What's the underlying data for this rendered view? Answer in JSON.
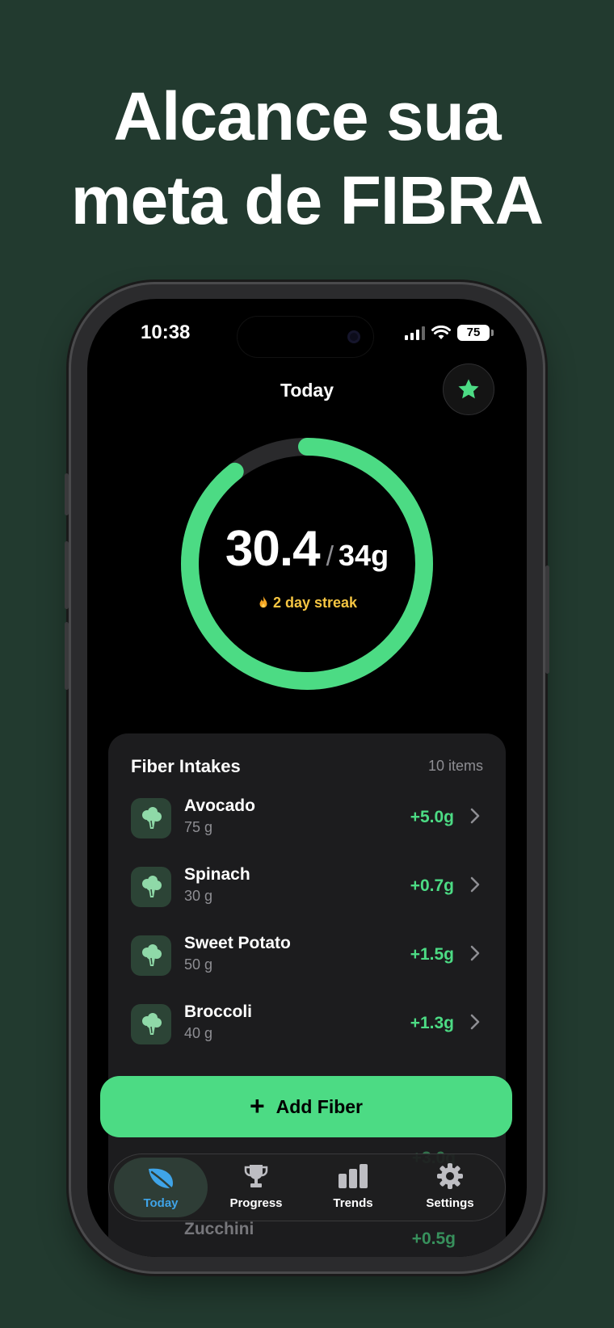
{
  "headline": {
    "line1": "Alcance sua",
    "line2": "meta de FIBRA"
  },
  "status_bar": {
    "time": "10:38",
    "battery": "75"
  },
  "nav": {
    "title": "Today",
    "star_icon": "star-icon"
  },
  "progress": {
    "value": "30.4",
    "separator": "/",
    "goal": "34g",
    "fraction": 0.894,
    "streak": "2 day streak",
    "streak_icon": "flame-icon"
  },
  "intakes": {
    "title": "Fiber Intakes",
    "count": "10 items",
    "items": [
      {
        "name": "Avocado",
        "amount": "75 g",
        "fiber": "+5.0g"
      },
      {
        "name": "Spinach",
        "amount": "30 g",
        "fiber": "+0.7g"
      },
      {
        "name": "Sweet Potato",
        "amount": "50 g",
        "fiber": "+1.5g"
      },
      {
        "name": "Broccoli",
        "amount": "40 g",
        "fiber": "+1.3g"
      }
    ],
    "partially_hidden": [
      {
        "fiber": "+3.0g"
      },
      {
        "name": "Zucchini",
        "fiber": "+0.5g"
      }
    ]
  },
  "add_button": {
    "label": "Add Fiber"
  },
  "tabs": [
    {
      "label": "Today",
      "icon": "leaf-icon",
      "active": true
    },
    {
      "label": "Progress",
      "icon": "trophy-icon",
      "active": false
    },
    {
      "label": "Trends",
      "icon": "bar-chart-icon",
      "active": false
    },
    {
      "label": "Settings",
      "icon": "gear-icon",
      "active": false
    }
  ],
  "colors": {
    "accent": "#4cdb84",
    "background": "#223a2f",
    "streak": "#f5c542",
    "tab_active": "#3fa4e8"
  }
}
